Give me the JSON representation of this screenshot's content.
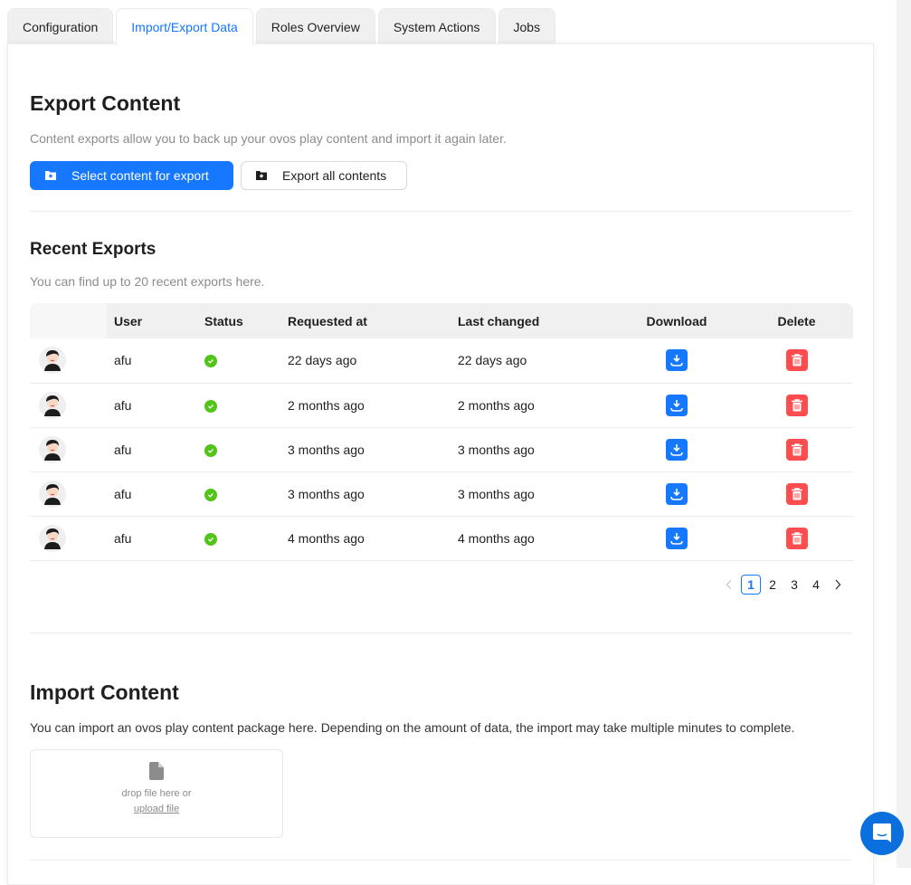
{
  "tabs": [
    {
      "label": "Configuration",
      "active": false
    },
    {
      "label": "Import/Export Data",
      "active": true
    },
    {
      "label": "Roles Overview",
      "active": false
    },
    {
      "label": "System Actions",
      "active": false
    },
    {
      "label": "Jobs",
      "active": false
    }
  ],
  "export": {
    "title": "Export Content",
    "description": "Content exports allow you to back up your ovos play content and import it again later.",
    "select_button": "Select content for export",
    "export_all_button": "Export all contents"
  },
  "recent": {
    "title": "Recent Exports",
    "description": "You can find up to 20 recent exports here.",
    "columns": [
      "",
      "User",
      "Status",
      "Requested at",
      "Last changed",
      "Download",
      "Delete"
    ],
    "rows": [
      {
        "user": "afu",
        "status": "success",
        "requested": "22 days ago",
        "changed": "22 days ago"
      },
      {
        "user": "afu",
        "status": "success",
        "requested": "2 months ago",
        "changed": "2 months ago"
      },
      {
        "user": "afu",
        "status": "success",
        "requested": "3 months ago",
        "changed": "3 months ago"
      },
      {
        "user": "afu",
        "status": "success",
        "requested": "3 months ago",
        "changed": "3 months ago"
      },
      {
        "user": "afu",
        "status": "success",
        "requested": "4 months ago",
        "changed": "4 months ago"
      }
    ],
    "pagination": {
      "pages": [
        "1",
        "2",
        "3",
        "4"
      ],
      "current": "1"
    }
  },
  "import": {
    "title": "Import Content",
    "description": "You can import an ovos play content package here. Depending on the amount of data, the import may take multiple minutes to complete.",
    "drop_text": "drop file here or",
    "upload_link": "upload file"
  },
  "colors": {
    "primary": "#1677ff",
    "danger": "#ff4d4f",
    "success": "#52c41a"
  }
}
